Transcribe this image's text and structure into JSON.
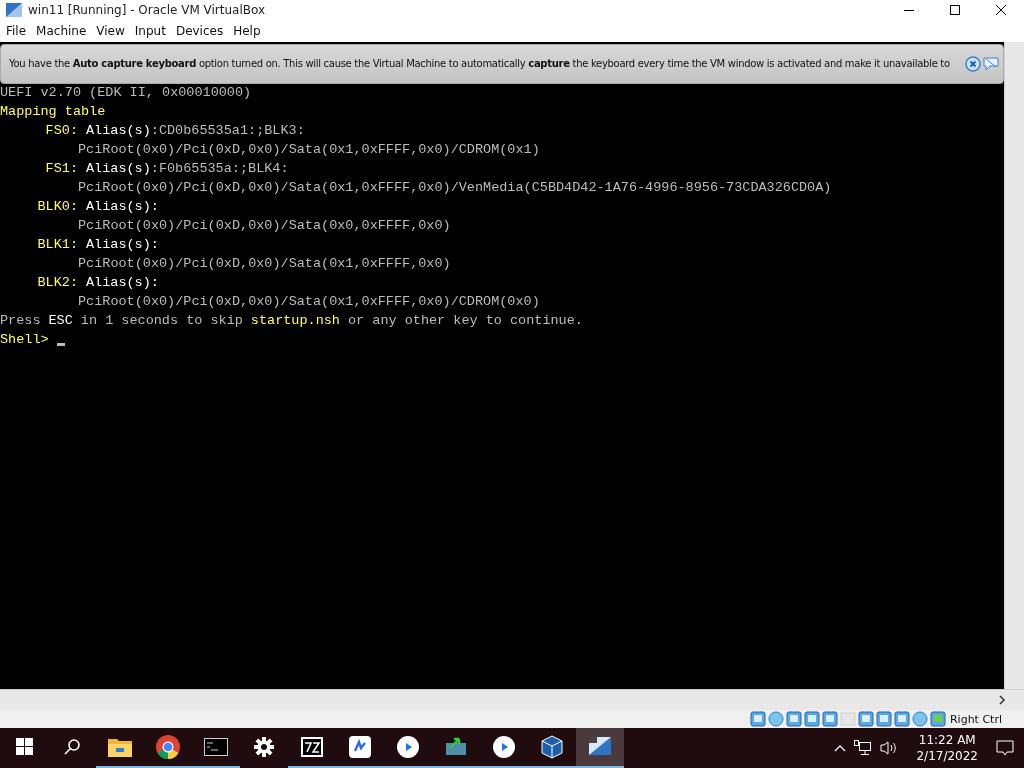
{
  "window": {
    "title": "win11 [Running] - Oracle VM VirtualBox"
  },
  "menu": [
    "File",
    "Machine",
    "View",
    "Input",
    "Devices",
    "Help"
  ],
  "banner": {
    "text": "You have the **Auto capture keyboard** option turned on. This will cause the Virtual Machine to automatically **capture** the keyboard every time the VM window is activated and make it unavailable to"
  },
  "terminal": {
    "lines": [
      {
        "kind": "plain",
        "segments": [
          {
            "text": "UEFI v2.70 (EDK II, 0x00010000)",
            "color": "#bcbcbc"
          }
        ]
      },
      {
        "kind": "plain",
        "segments": [
          {
            "text": "Mapping table",
            "color": "#ffff55"
          }
        ]
      },
      {
        "kind": "mapping",
        "label": "FS0:",
        "segments": [
          {
            "text": "Alias(s)",
            "color": "#ffffff"
          },
          {
            "text": ":CD0b65535a1:;BLK3:",
            "color": "#bcbcbc"
          }
        ]
      },
      {
        "kind": "path",
        "segments": [
          {
            "text": "PciRoot(0x0)/Pci(0xD,0x0)/Sata(0x1,0xFFFF,0x0)/CDROM(0x1)",
            "color": "#bcbcbc"
          }
        ]
      },
      {
        "kind": "mapping",
        "label": "FS1:",
        "segments": [
          {
            "text": "Alias(s)",
            "color": "#ffffff"
          },
          {
            "text": ":F0b65535a:;BLK4:",
            "color": "#bcbcbc"
          }
        ]
      },
      {
        "kind": "path",
        "segments": [
          {
            "text": "PciRoot(0x0)/Pci(0xD,0x0)/Sata(0x1,0xFFFF,0x0)/VenMedia(C5BD4D42-1A76-4996-8956-73CDA326CD0A)",
            "color": "#bcbcbc"
          }
        ]
      },
      {
        "kind": "mapping",
        "label": "BLK0:",
        "segments": [
          {
            "text": "Alias(s):",
            "color": "#ffffff"
          }
        ]
      },
      {
        "kind": "path",
        "segments": [
          {
            "text": "PciRoot(0x0)/Pci(0xD,0x0)/Sata(0x0,0xFFFF,0x0)",
            "color": "#bcbcbc"
          }
        ]
      },
      {
        "kind": "mapping",
        "label": "BLK1:",
        "segments": [
          {
            "text": "Alias(s):",
            "color": "#ffffff"
          }
        ]
      },
      {
        "kind": "path",
        "segments": [
          {
            "text": "PciRoot(0x0)/Pci(0xD,0x0)/Sata(0x1,0xFFFF,0x0)",
            "color": "#bcbcbc"
          }
        ]
      },
      {
        "kind": "mapping",
        "label": "BLK2:",
        "segments": [
          {
            "text": "Alias(s):",
            "color": "#ffffff"
          }
        ]
      },
      {
        "kind": "path",
        "segments": [
          {
            "text": "PciRoot(0x0)/Pci(0xD,0x0)/Sata(0x1,0xFFFF,0x0)/CDROM(0x0)",
            "color": "#bcbcbc"
          }
        ]
      },
      {
        "kind": "plain",
        "segments": [
          {
            "text": "Press",
            "color": "#bcbcbc"
          },
          {
            "text": "ESC",
            "color": "#ffffff"
          },
          {
            "text": "in 1 seconds to skip",
            "color": "#bcbcbc"
          },
          {
            "text": "startup.nsh",
            "color": "#ffff55"
          },
          {
            "text": "or any other key to continue.",
            "color": "#bcbcbc"
          }
        ]
      },
      {
        "kind": "prompt",
        "segments": [
          {
            "text": "Shell>",
            "color": "#ffff55"
          }
        ]
      }
    ]
  },
  "status_bar": {
    "host_key": "Right Ctrl"
  },
  "taskbar": {
    "apps": [
      {
        "kind": "start",
        "running": false,
        "selected": false
      },
      {
        "kind": "search",
        "running": false,
        "selected": false
      },
      {
        "kind": "folder",
        "running": true,
        "selected": false
      },
      {
        "kind": "chrome",
        "running": true,
        "selected": false
      },
      {
        "kind": "terminal",
        "running": true,
        "selected": false
      },
      {
        "kind": "gear",
        "running": false,
        "selected": false
      },
      {
        "kind": "archive",
        "running": true,
        "selected": false
      },
      {
        "kind": "app",
        "running": true,
        "selected": false
      },
      {
        "kind": "play",
        "running": true,
        "selected": false
      },
      {
        "kind": "monitor",
        "running": true,
        "selected": false
      },
      {
        "kind": "play",
        "running": true,
        "selected": false
      },
      {
        "kind": "cube",
        "running": true,
        "selected": false
      },
      {
        "kind": "vm",
        "running": true,
        "selected": true
      }
    ],
    "time": "11:22 AM",
    "date": "2/17/2022"
  }
}
